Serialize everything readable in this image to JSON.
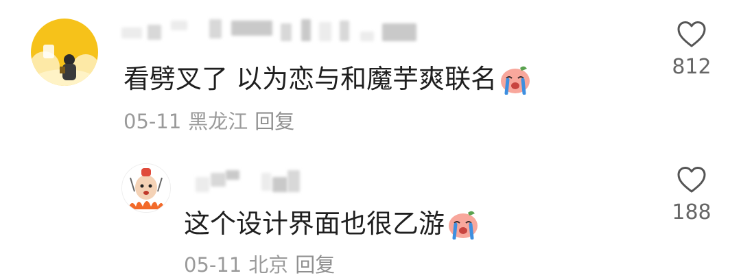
{
  "comments": [
    {
      "text": "看劈叉了 以为恋与和魔芋爽联名",
      "emoji": "crying-face-emoji",
      "date": "05-11",
      "location": "黑龙江",
      "reply_label": "回复",
      "likes": "812",
      "avatar": "cartoon-yellow-avatar",
      "username_redacted": true
    },
    {
      "text": "这个设计界面也很乙游",
      "emoji": "crying-face-emoji",
      "date": "05-11",
      "location": "北京",
      "reply_label": "回复",
      "likes": "188",
      "avatar": "cartoon-character-avatar",
      "username_redacted": true
    }
  ],
  "icons": {
    "like": "heart-outline-icon"
  },
  "colors": {
    "text": "#1f1f1f",
    "meta": "#9a9a9a",
    "count": "#666666"
  }
}
